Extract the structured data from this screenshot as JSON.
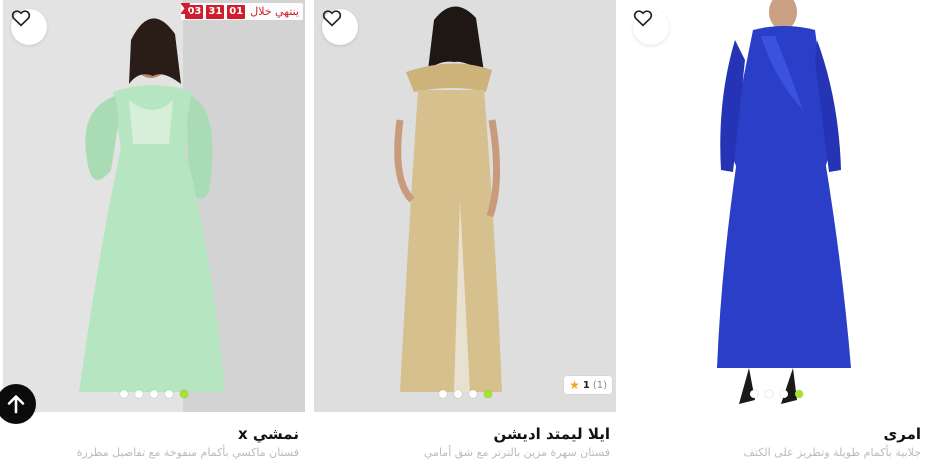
{
  "products": [
    {
      "brand": "نمشي x",
      "subtitle": "فستان ماكسي بأكمام منفوخة مع تفاصيل مطرزة",
      "timer": {
        "label": "ينتهي خلال",
        "hours": "01",
        "minutes": "31",
        "seconds": "03",
        "icon": "hourglass-icon"
      },
      "image_bg": "#e6e6e6",
      "dress_color": "#b6e6c1",
      "dots": 5,
      "active_dot": 4
    },
    {
      "brand": "ايلا ليمتد اديشن",
      "subtitle": "فستان سهرة مزين بالترتر مع شق أمامي",
      "rating": {
        "score": "1",
        "count": "(1)",
        "star_color": "#f5a623"
      },
      "image_bg": "#dcdcdc",
      "dress_color": "#d6c08e",
      "dots": 4,
      "active_dot": 3
    },
    {
      "brand": "امرى",
      "subtitle": "جلابية بأكمام طويلة وتطريز على الكتف",
      "image_bg": "#ffffff",
      "dress_color": "#2a3ec8",
      "dots": 4,
      "active_dot": 3
    }
  ],
  "icons": {
    "wishlist": "heart-icon",
    "scroll_top": "arrow-up-icon",
    "rating_star": "star-icon"
  },
  "colors": {
    "accent_dot": "#a6e22e",
    "timer_red": "#cf1f2f",
    "text": "#111111"
  }
}
